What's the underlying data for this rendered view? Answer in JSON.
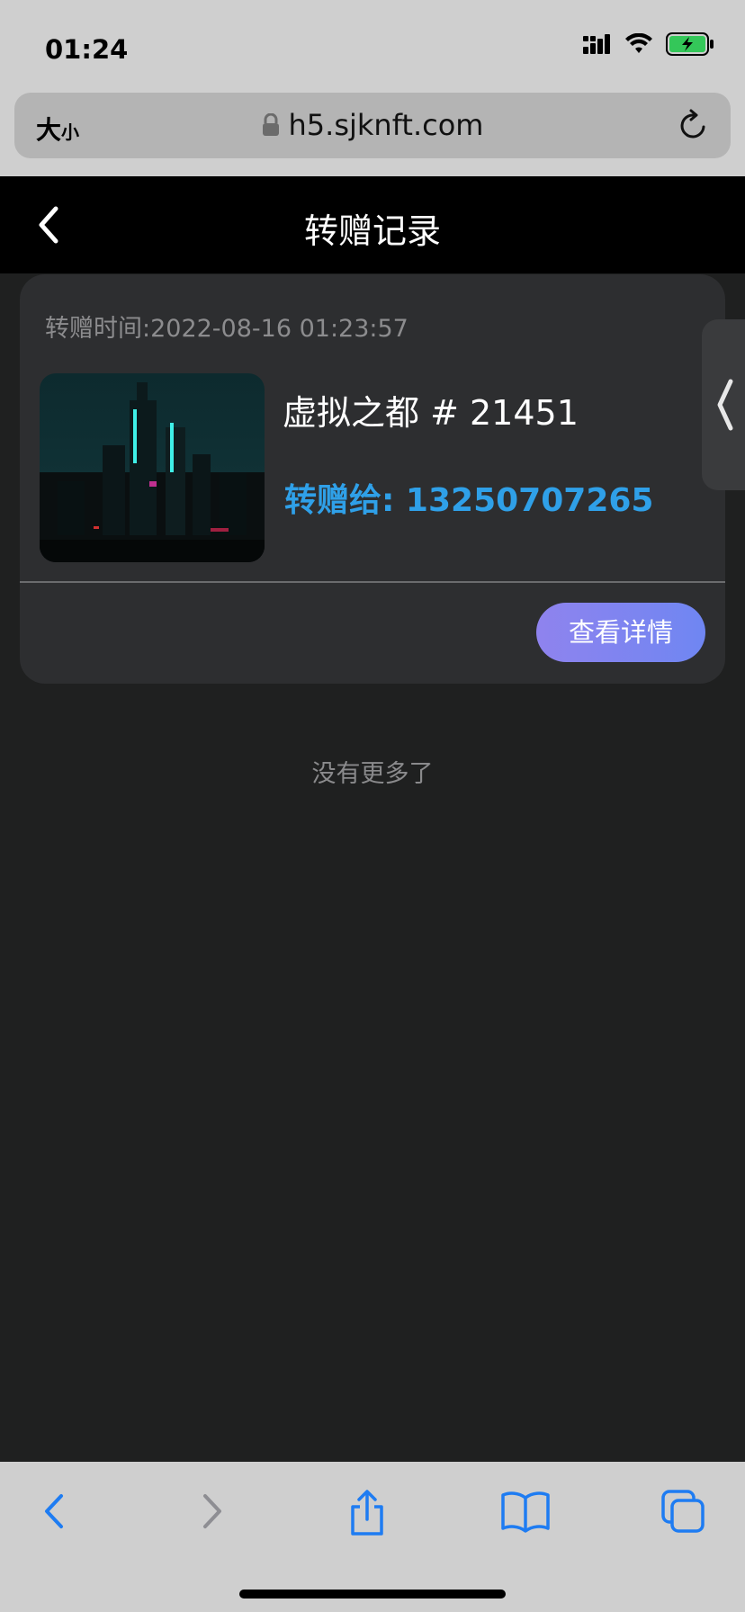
{
  "status_bar": {
    "time": "01:24"
  },
  "browser": {
    "size_label_big": "大",
    "size_label_small": "小",
    "url": "h5.sjknft.com"
  },
  "header": {
    "title": "转赠记录"
  },
  "records": [
    {
      "time_label": "转赠时间:2022-08-16  01:23:57",
      "name": "虚拟之都 # 21451",
      "recipient_label": "转赠给: 13250707265",
      "detail_button": "查看详情"
    }
  ],
  "footer_note": "没有更多了",
  "colors": {
    "accent_blue": "#2fa0e8",
    "button_gradient_start": "#8f83ee",
    "button_gradient_end": "#6f86f2",
    "ios_blue": "#1e7cf2",
    "battery_green": "#34c759"
  },
  "icons": {
    "back": "chevron-left-icon",
    "lock": "lock-icon",
    "reload": "reload-icon",
    "share": "share-icon",
    "bookmarks": "book-icon",
    "tabs": "tabs-icon"
  }
}
